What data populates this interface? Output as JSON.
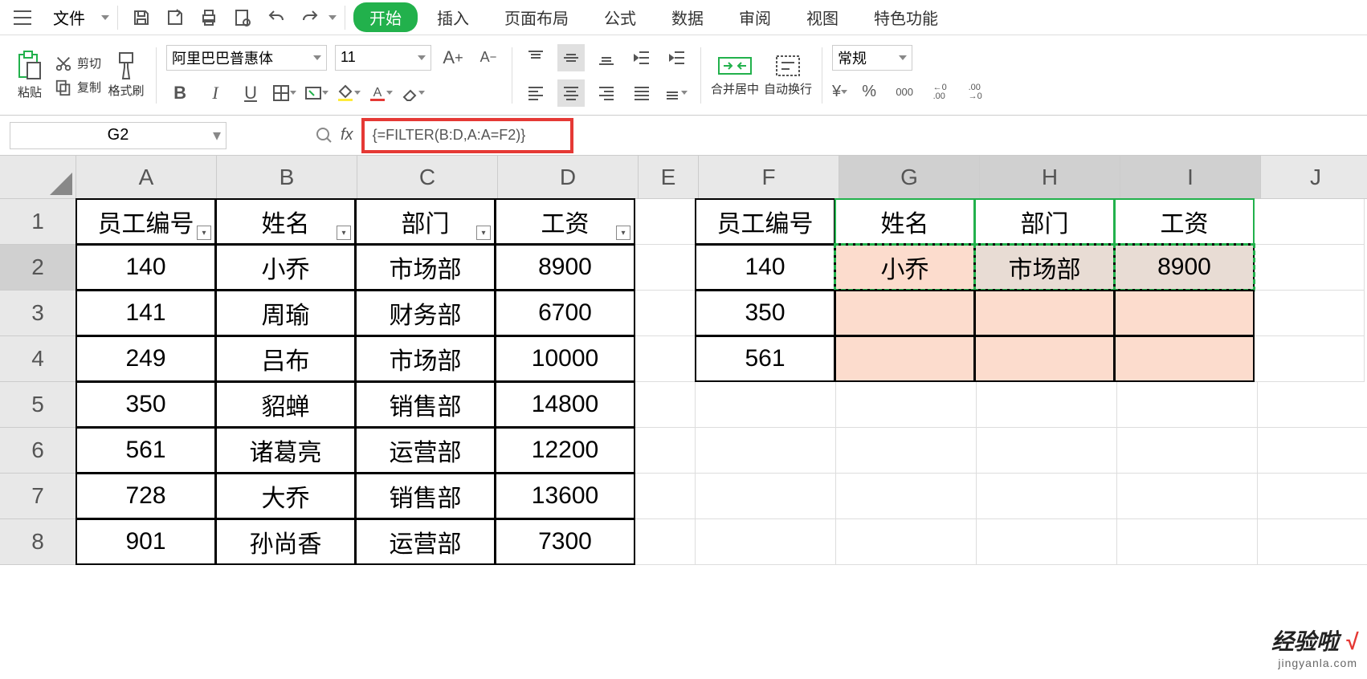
{
  "menu": {
    "file": "文件",
    "tabs": {
      "start": "开始",
      "insert": "插入",
      "page_layout": "页面布局",
      "formula": "公式",
      "data": "数据",
      "review": "审阅",
      "view": "视图",
      "special": "特色功能"
    }
  },
  "ribbon": {
    "paste": "粘贴",
    "cut": "剪切",
    "copy": "复制",
    "format_painter": "格式刷",
    "font_name": "阿里巴巴普惠体",
    "font_size": "11",
    "merge_center": "合并居中",
    "wrap_text": "自动换行",
    "number_format": "常规",
    "thousands": "000",
    "dec_inc": "←0\n.00",
    "dec_dec": ".00\n→0"
  },
  "formula_bar": {
    "cell_ref": "G2",
    "formula": "{=FILTER(B:D,A:A=F2)}"
  },
  "columns": [
    "A",
    "B",
    "C",
    "D",
    "E",
    "F",
    "G",
    "H",
    "I",
    "J"
  ],
  "rows": [
    "1",
    "2",
    "3",
    "4",
    "5",
    "6",
    "7",
    "8"
  ],
  "headers1": {
    "A": "员工编号",
    "B": "姓名",
    "C": "部门",
    "D": "工资"
  },
  "headers2": {
    "F": "员工编号",
    "G": "姓名",
    "H": "部门",
    "I": "工资"
  },
  "table1": [
    {
      "id": "140",
      "name": "小乔",
      "dept": "市场部",
      "salary": "8900"
    },
    {
      "id": "141",
      "name": "周瑜",
      "dept": "财务部",
      "salary": "6700"
    },
    {
      "id": "249",
      "name": "吕布",
      "dept": "市场部",
      "salary": "10000"
    },
    {
      "id": "350",
      "name": "貂蝉",
      "dept": "销售部",
      "salary": "14800"
    },
    {
      "id": "561",
      "name": "诸葛亮",
      "dept": "运营部",
      "salary": "12200"
    },
    {
      "id": "728",
      "name": "大乔",
      "dept": "销售部",
      "salary": "13600"
    },
    {
      "id": "901",
      "name": "孙尚香",
      "dept": "运营部",
      "salary": "7300"
    }
  ],
  "lookup": {
    "f2": "140",
    "f3": "350",
    "f4": "561",
    "g2": "小乔",
    "h2": "市场部",
    "i2": "8900"
  },
  "watermark": {
    "l1a": "经验啦",
    "l1b": "√",
    "l2": "jingyanla.com"
  }
}
